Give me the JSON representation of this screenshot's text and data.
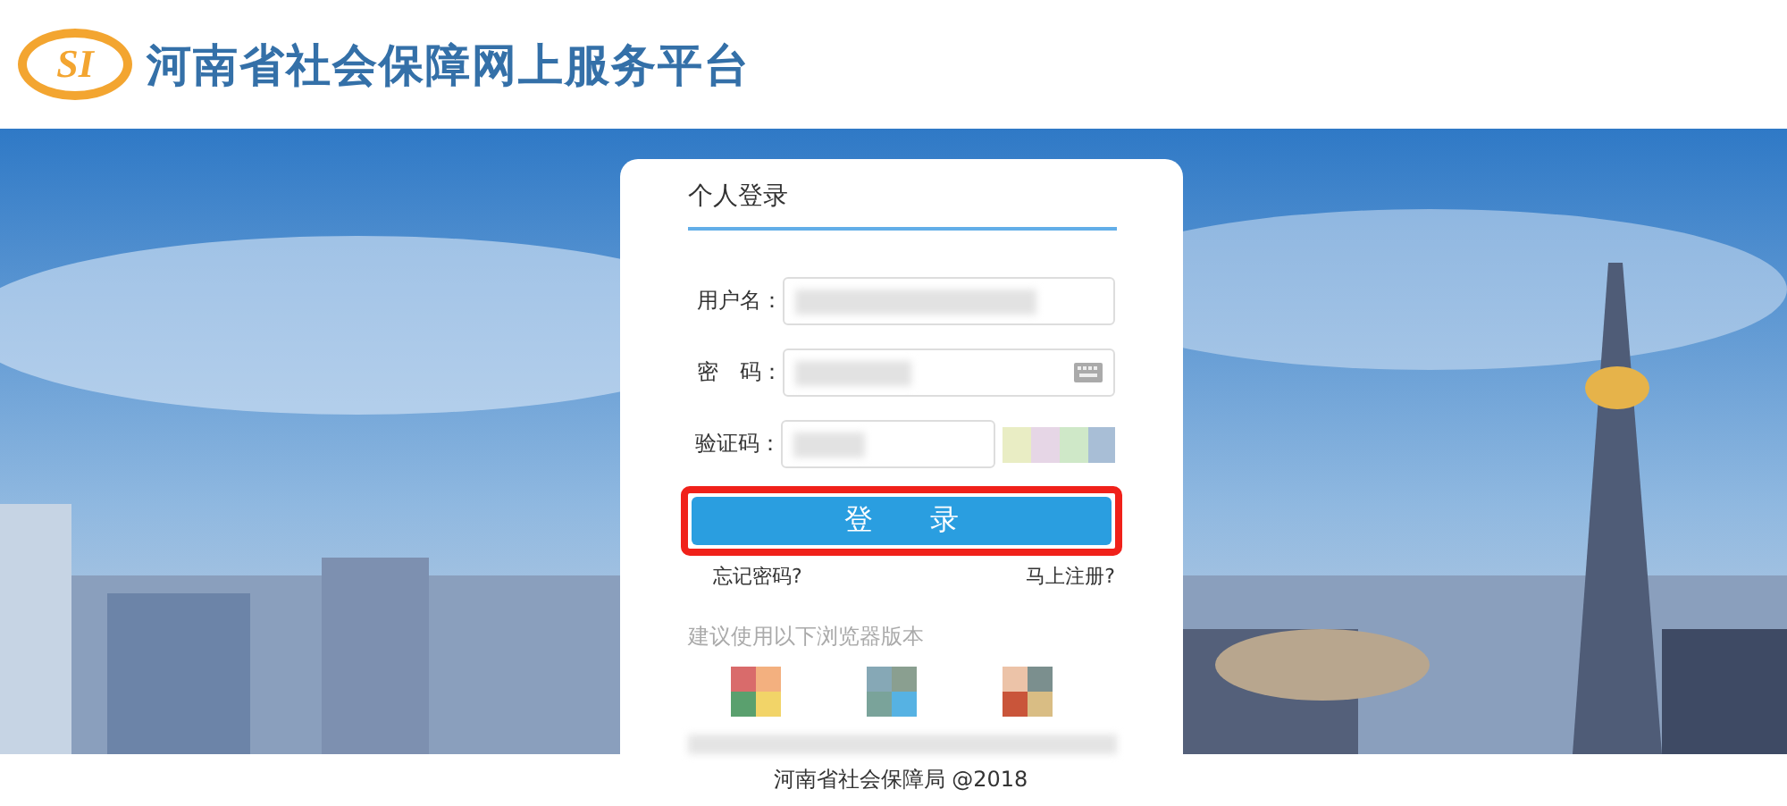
{
  "header": {
    "logo_text": "SI",
    "title": "河南省社会保障网上服务平台"
  },
  "login": {
    "title": "个人登录",
    "fields": [
      {
        "label": "用户名：",
        "kind": "text"
      },
      {
        "label": "密　码：",
        "kind": "password"
      },
      {
        "label": "验证码：",
        "kind": "captcha"
      }
    ],
    "submit": "登　　录",
    "highlighted": true,
    "links": [
      "忘记密码?",
      "马上注册?"
    ],
    "browser_hint": "建议使用以下浏览器版本"
  },
  "footer": "河南省社会保障局 @2018"
}
